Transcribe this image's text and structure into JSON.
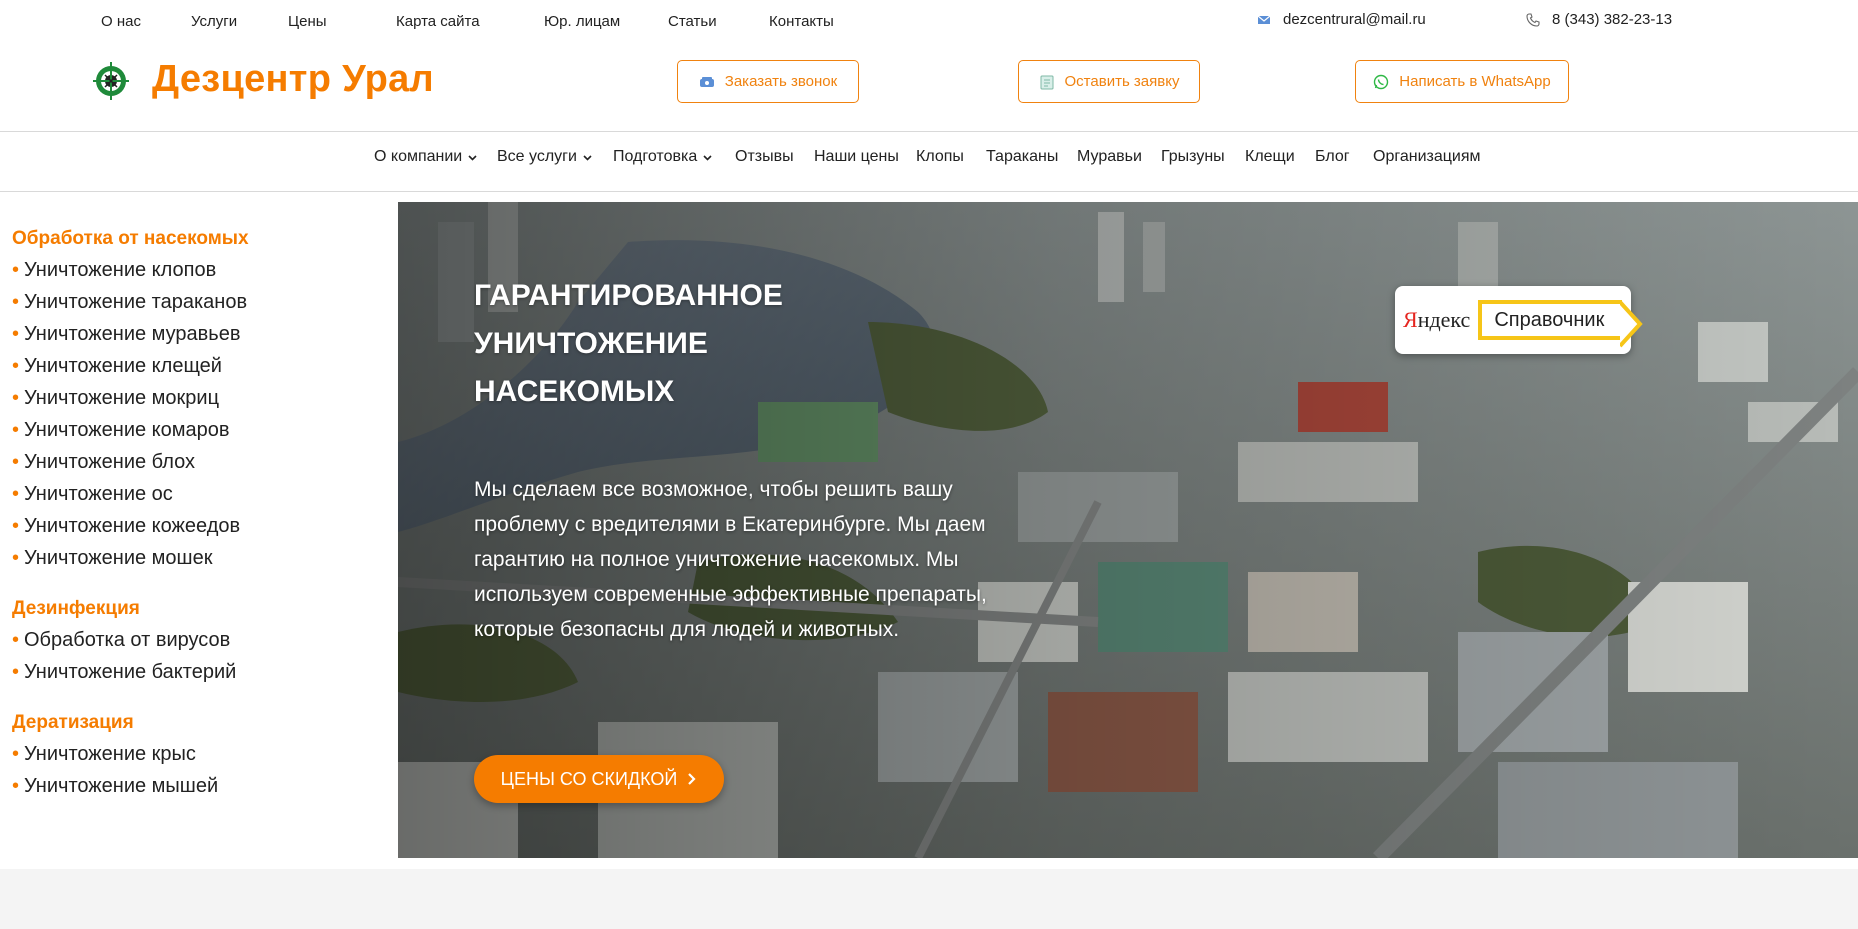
{
  "topnav": {
    "items": [
      {
        "label": "О нас"
      },
      {
        "label": "Услуги"
      },
      {
        "label": "Цены"
      },
      {
        "label": "Карта сайта"
      },
      {
        "label": "Юр. лицам"
      },
      {
        "label": "Статьи"
      },
      {
        "label": "Контакты"
      }
    ],
    "email": "dezcentrural@mail.ru",
    "phone": "8 (343) 382-23-13"
  },
  "header": {
    "logo_text": "Дезцентр Урал",
    "call_button": "Заказать звонок",
    "request_button": "Оставить заявку",
    "whatsapp_button": "Написать в WhatsApp"
  },
  "mainnav": {
    "items": [
      {
        "label": "О компании",
        "has_dropdown": true
      },
      {
        "label": "Все услуги",
        "has_dropdown": true
      },
      {
        "label": "Подготовка",
        "has_dropdown": true
      },
      {
        "label": "Отзывы"
      },
      {
        "label": "Наши цены"
      },
      {
        "label": "Клопы"
      },
      {
        "label": "Тараканы"
      },
      {
        "label": "Муравьи"
      },
      {
        "label": "Грызуны"
      },
      {
        "label": "Клещи"
      },
      {
        "label": "Блог"
      },
      {
        "label": "Организациям"
      }
    ]
  },
  "sidebar": {
    "groups": [
      {
        "heading": "Обработка от насекомых",
        "items": [
          "Уничтожение клопов",
          "Уничтожение тараканов",
          "Уничтожение муравьев",
          "Уничтожение клещей",
          "Уничтожение мокриц",
          "Уничтожение комаров",
          "Уничтожение блох",
          "Уничтожение ос",
          "Уничтожение кожеедов",
          "Уничтожение мошек"
        ]
      },
      {
        "heading": "Дезинфекция",
        "items": [
          "Обработка от вирусов",
          "Уничтожение бактерий"
        ]
      },
      {
        "heading": "Дератизация",
        "items": [
          "Уничтожение крыс",
          "Уничтожение мышей"
        ]
      }
    ]
  },
  "hero": {
    "title": "Гарантированное уничтожение насекомых",
    "text": "Мы сделаем все возможное, чтобы решить вашу проблему с вредителями в Екатеринбурге. Мы даем гарантию на полное уничтожение насекомых. Мы используем современные эффективные препараты, которые безопасны для людей и животных.",
    "cta": "ЦЕНЫ СО СКИДКОЙ",
    "badge_brand_first": "Я",
    "badge_brand_rest": "ндекс",
    "badge_tag": "Справочник"
  },
  "colors": {
    "accent": "#f57c00",
    "text": "#222222",
    "yandex_red": "#e52620",
    "yandex_yellow": "#f6c518"
  }
}
